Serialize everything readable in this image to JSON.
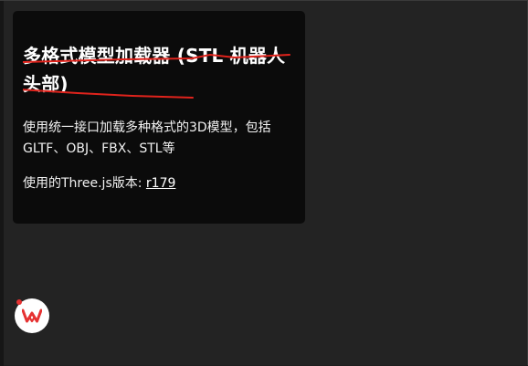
{
  "panel": {
    "title": "多格式模型加载器 (STL 机器人头部)",
    "description": "使用统一接口加载多种格式的3D模型，包括GLTF、OBJ、FBX、STL等",
    "version_prefix": "使用的Three.js版本: ",
    "version_link": "r179"
  },
  "colors": {
    "panel_background": "#0b0b0b",
    "page_background": "#232323",
    "strike_annotation": "#e0231c",
    "badge_accent": "#e63232"
  },
  "icons": {
    "app_badge": "wps-logo-icon"
  }
}
